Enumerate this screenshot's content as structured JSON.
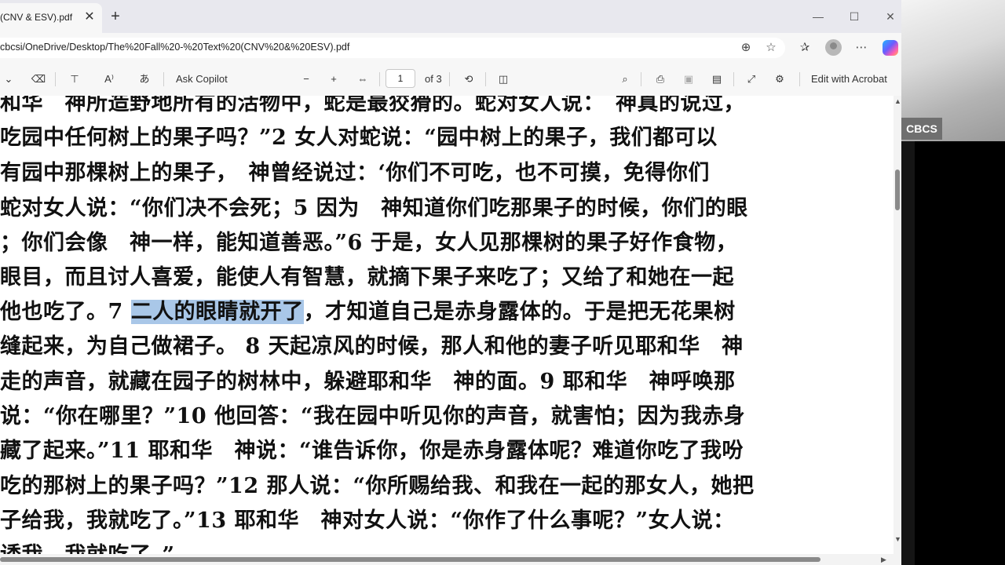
{
  "tab": {
    "title": "(CNV & ESV).pdf",
    "close": "✕",
    "new_tab": "+"
  },
  "window": {
    "minimize": "—",
    "maximize": "☐",
    "close": "✕"
  },
  "address": {
    "url": "cbcsi/OneDrive/Desktop/The%20Fall%20-%20Text%20(CNV%20&%20ESV).pdf"
  },
  "toolbar": {
    "ask_copilot": "Ask Copilot",
    "page_current": "1",
    "page_total": "of 3",
    "edit_with_acrobat": "Edit with Acrobat"
  },
  "document": {
    "lines": [
      "和华　神所造野地所有的活物中，蛇是最狡猾的。蛇对女人说：　神真的说过，",
      "吃园中任何树上的果子吗？”2 女人对蛇说：“园中树上的果子，我们都可以",
      "有园中那棵树上的果子，　神曾经说过：‘你们不可吃，也不可摸，免得你们",
      "蛇对女人说：“你们决不会死；5 因为　神知道你们吃那果子的时候，你们的眼",
      "；你们会像　神一样，能知道善恶。”6 于是，女人见那棵树的果子好作食物，",
      "眼目，而且讨人喜爱，能使人有智慧，就摘下果子来吃了；又给了和她在一起",
      "他也吃了。7 ",
      "缝起来，为自己做裙子。 8 天起凉风的时候，那人和他的妻子听见耶和华　神",
      "走的声音，就藏在园子的树林中，躲避耶和华　神的面。9 耶和华　神呼唤那",
      "说：“你在哪里？”10 他回答：“我在园中听见你的声音，就害怕；因为我赤身",
      "藏了起来。”11 耶和华　神说：“谁告诉你，你是赤身露体呢？难道你吃了我吩",
      "吃的那树上的果子吗？”12 那人说：“你所赐给我、和我在一起的那女人，她把",
      "子给我，我就吃了。”13 耶和华　神对女人说：“你作了什么事呢？”女人说：",
      "诱我，我就吃了。”"
    ],
    "highlight": "二人的眼睛就开了",
    "after_highlight": "，才知道自己是赤身露体的。于是把无花果树"
  },
  "overlay": {
    "label": "CBCS"
  }
}
